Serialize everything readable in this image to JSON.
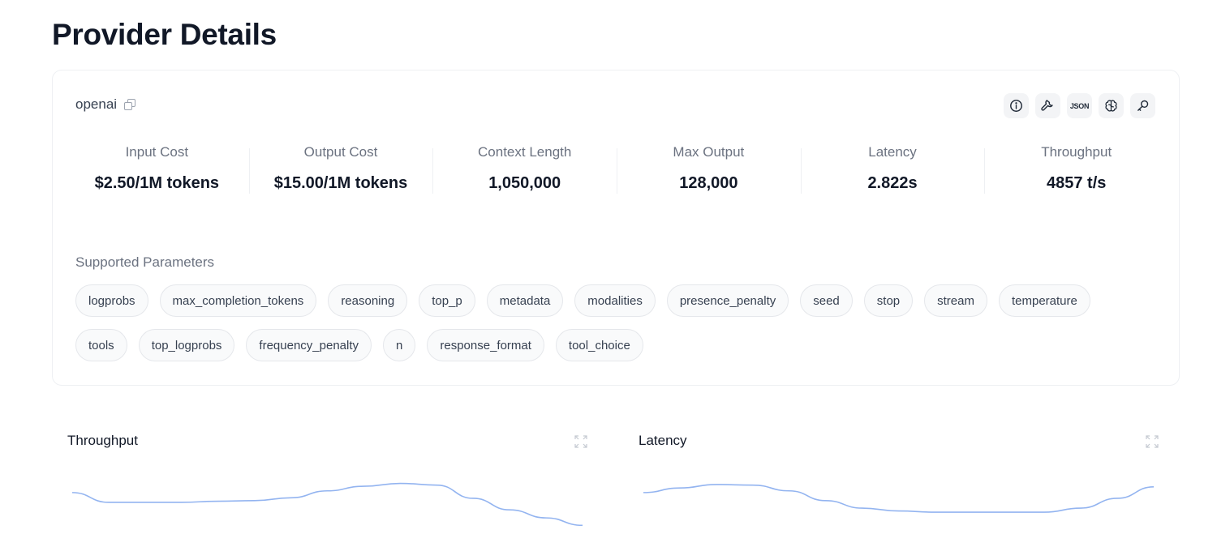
{
  "page": {
    "title": "Provider Details"
  },
  "provider": {
    "name": "openai",
    "toolbar": [
      {
        "icon": "info-icon"
      },
      {
        "icon": "wrench-icon"
      },
      {
        "icon": "json-icon",
        "label": "JSON"
      },
      {
        "icon": "brain-icon"
      },
      {
        "icon": "key-icon"
      }
    ]
  },
  "stats": [
    {
      "label": "Input Cost",
      "value": "$2.50/1M tokens"
    },
    {
      "label": "Output Cost",
      "value": "$15.00/1M tokens"
    },
    {
      "label": "Context Length",
      "value": "1,050,000"
    },
    {
      "label": "Max Output",
      "value": "128,000"
    },
    {
      "label": "Latency",
      "value": "2.822s"
    },
    {
      "label": "Throughput",
      "value": "4857 t/s"
    }
  ],
  "params": {
    "title": "Supported Parameters",
    "items": [
      "logprobs",
      "max_completion_tokens",
      "reasoning",
      "top_p",
      "metadata",
      "modalities",
      "presence_penalty",
      "seed",
      "stop",
      "stream",
      "temperature",
      "tools",
      "top_logprobs",
      "frequency_penalty",
      "n",
      "response_format",
      "tool_choice"
    ]
  },
  "panels": {
    "throughput": {
      "title": "Throughput"
    },
    "latency": {
      "title": "Latency"
    }
  },
  "chart_data": [
    {
      "type": "line",
      "title": "Throughput",
      "series": [
        {
          "values": [
            0.72,
            0.55,
            0.55,
            0.55,
            0.57,
            0.58,
            0.63,
            0.75,
            0.83,
            0.88,
            0.85,
            0.62,
            0.42,
            0.28,
            0.15
          ]
        }
      ],
      "color": "#93b4f0"
    },
    {
      "type": "line",
      "title": "Latency",
      "series": [
        {
          "values": [
            0.72,
            0.8,
            0.86,
            0.85,
            0.75,
            0.58,
            0.45,
            0.4,
            0.38,
            0.38,
            0.38,
            0.38,
            0.45,
            0.62,
            0.82
          ]
        }
      ],
      "color": "#93b4f0"
    }
  ]
}
